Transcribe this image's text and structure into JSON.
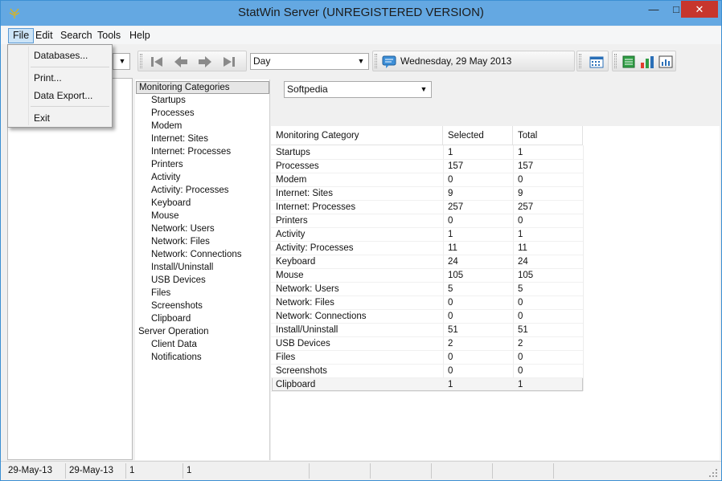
{
  "window": {
    "title": "StatWin Server (UNREGISTERED VERSION)",
    "controls": {
      "minimize": "—",
      "maximize": "□",
      "close": "✕"
    }
  },
  "menubar": {
    "items": [
      "File",
      "Edit",
      "Search",
      "Tools",
      "Help"
    ],
    "active": "File"
  },
  "file_menu": {
    "items": [
      "Databases...",
      "Print...",
      "Data Export...",
      "Exit"
    ]
  },
  "toolbar": {
    "period_select": "Day",
    "date": "Wednesday, 29 May 2013",
    "icons": [
      "first-icon",
      "previous-icon",
      "next-icon",
      "last-icon",
      "calendar-icon",
      "list-view-icon",
      "bar-chart-icon",
      "chart-report-icon"
    ]
  },
  "computer_select": "Softpedia",
  "tree": {
    "items": [
      {
        "label": "Monitoring Categories",
        "level": 0
      },
      {
        "label": "Startups",
        "level": 1
      },
      {
        "label": "Processes",
        "level": 1
      },
      {
        "label": "Modem",
        "level": 1
      },
      {
        "label": "Internet: Sites",
        "level": 1
      },
      {
        "label": "Internet: Processes",
        "level": 1
      },
      {
        "label": "Printers",
        "level": 1
      },
      {
        "label": "Activity",
        "level": 1
      },
      {
        "label": "Activity: Processes",
        "level": 1
      },
      {
        "label": "Keyboard",
        "level": 1
      },
      {
        "label": "Mouse",
        "level": 1
      },
      {
        "label": "Network: Users",
        "level": 1
      },
      {
        "label": "Network: Files",
        "level": 1
      },
      {
        "label": "Network: Connections",
        "level": 1
      },
      {
        "label": "Install/Uninstall",
        "level": 1
      },
      {
        "label": "USB Devices",
        "level": 1
      },
      {
        "label": "Files",
        "level": 1
      },
      {
        "label": "Screenshots",
        "level": 1
      },
      {
        "label": "Clipboard",
        "level": 1
      },
      {
        "label": "Server Operation",
        "level": 0
      },
      {
        "label": "Client Data",
        "level": 1
      },
      {
        "label": "Notifications",
        "level": 1
      }
    ]
  },
  "grid": {
    "columns": [
      "Monitoring Category",
      "Selected",
      "Total"
    ],
    "rows": [
      [
        "Startups",
        "1",
        "1"
      ],
      [
        "Processes",
        "157",
        "157"
      ],
      [
        "Modem",
        "0",
        "0"
      ],
      [
        "Internet: Sites",
        "9",
        "9"
      ],
      [
        "Internet: Processes",
        "257",
        "257"
      ],
      [
        "Printers",
        "0",
        "0"
      ],
      [
        "Activity",
        "1",
        "1"
      ],
      [
        "Activity: Processes",
        "11",
        "11"
      ],
      [
        "Keyboard",
        "24",
        "24"
      ],
      [
        "Mouse",
        "105",
        "105"
      ],
      [
        "Network: Users",
        "5",
        "5"
      ],
      [
        "Network: Files",
        "0",
        "0"
      ],
      [
        "Network: Connections",
        "0",
        "0"
      ],
      [
        "Install/Uninstall",
        "51",
        "51"
      ],
      [
        "USB Devices",
        "2",
        "2"
      ],
      [
        "Files",
        "0",
        "0"
      ],
      [
        "Screenshots",
        "0",
        "0"
      ],
      [
        "Clipboard",
        "1",
        "1"
      ]
    ]
  },
  "statusbar": {
    "cells": [
      "29-May-13",
      "29-May-13",
      "1",
      "1",
      "",
      "",
      "",
      ""
    ]
  }
}
